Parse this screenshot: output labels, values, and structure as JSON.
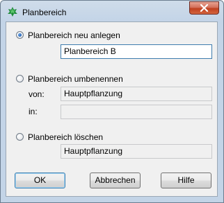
{
  "window": {
    "title": "Planbereich"
  },
  "options": {
    "create": {
      "label": "Planbereich neu anlegen",
      "checked": true,
      "value": "Planbereich B"
    },
    "rename": {
      "label": "Planbereich umbenennen",
      "checked": false,
      "from_label": "von:",
      "from_value": "Hauptpflanzung",
      "to_label": "in:",
      "to_value": ""
    },
    "delete": {
      "label": "Planbereich löschen",
      "checked": false,
      "value": "Hauptpflanzung"
    }
  },
  "buttons": {
    "ok": "OK",
    "cancel": "Abbrechen",
    "help": "Hilfe"
  },
  "colors": {
    "accent": "#3c7fb1",
    "close_button": "#c0401f"
  },
  "icons": {
    "app": "green-leaf-icon",
    "close": "close-icon"
  }
}
